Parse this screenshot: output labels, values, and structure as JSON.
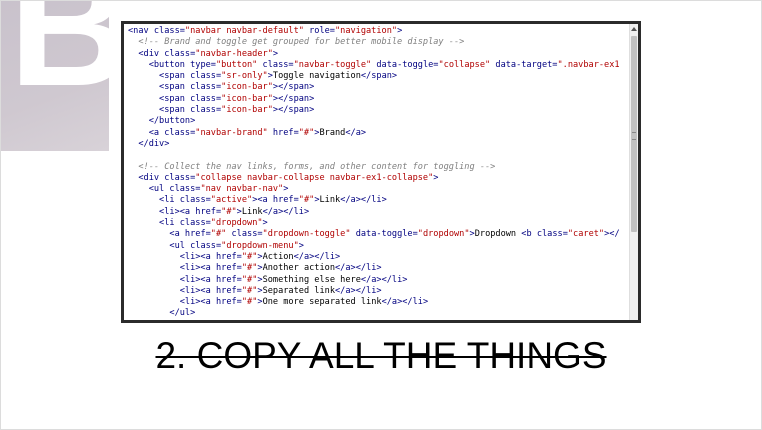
{
  "logo": {
    "letter": "B"
  },
  "code_lines": [
    [
      {
        "t": "tag",
        "v": "<nav "
      },
      {
        "t": "attr",
        "v": "class="
      },
      {
        "t": "str",
        "v": "\"navbar navbar-default\""
      },
      {
        "t": "attr",
        "v": " role="
      },
      {
        "t": "str",
        "v": "\"navigation\""
      },
      {
        "t": "tag",
        "v": ">"
      }
    ],
    [
      {
        "t": "comment",
        "v": "  <!-- Brand and toggle get grouped for better mobile display -->"
      }
    ],
    [
      {
        "t": "tag",
        "v": "  <div "
      },
      {
        "t": "attr",
        "v": "class="
      },
      {
        "t": "str",
        "v": "\"navbar-header\""
      },
      {
        "t": "tag",
        "v": ">"
      }
    ],
    [
      {
        "t": "tag",
        "v": "    <button "
      },
      {
        "t": "attr",
        "v": "type="
      },
      {
        "t": "str",
        "v": "\"button\""
      },
      {
        "t": "attr",
        "v": " class="
      },
      {
        "t": "str",
        "v": "\"navbar-toggle\""
      },
      {
        "t": "attr",
        "v": " data-toggle="
      },
      {
        "t": "str",
        "v": "\"collapse\""
      },
      {
        "t": "attr",
        "v": " data-target="
      },
      {
        "t": "str",
        "v": "\".navbar-ex1"
      }
    ],
    [
      {
        "t": "tag",
        "v": "      <span "
      },
      {
        "t": "attr",
        "v": "class="
      },
      {
        "t": "str",
        "v": "\"sr-only\""
      },
      {
        "t": "tag",
        "v": ">"
      },
      {
        "t": "text",
        "v": "Toggle navigation"
      },
      {
        "t": "tag",
        "v": "</span>"
      }
    ],
    [
      {
        "t": "tag",
        "v": "      <span "
      },
      {
        "t": "attr",
        "v": "class="
      },
      {
        "t": "str",
        "v": "\"icon-bar\""
      },
      {
        "t": "tag",
        "v": "></span>"
      }
    ],
    [
      {
        "t": "tag",
        "v": "      <span "
      },
      {
        "t": "attr",
        "v": "class="
      },
      {
        "t": "str",
        "v": "\"icon-bar\""
      },
      {
        "t": "tag",
        "v": "></span>"
      }
    ],
    [
      {
        "t": "tag",
        "v": "      <span "
      },
      {
        "t": "attr",
        "v": "class="
      },
      {
        "t": "str",
        "v": "\"icon-bar\""
      },
      {
        "t": "tag",
        "v": "></span>"
      }
    ],
    [
      {
        "t": "tag",
        "v": "    </button>"
      }
    ],
    [
      {
        "t": "tag",
        "v": "    <a "
      },
      {
        "t": "attr",
        "v": "class="
      },
      {
        "t": "str",
        "v": "\"navbar-brand\""
      },
      {
        "t": "attr",
        "v": " href="
      },
      {
        "t": "str",
        "v": "\"#\""
      },
      {
        "t": "tag",
        "v": ">"
      },
      {
        "t": "text",
        "v": "Brand"
      },
      {
        "t": "tag",
        "v": "</a>"
      }
    ],
    [
      {
        "t": "tag",
        "v": "  </div>"
      }
    ],
    [
      {
        "t": "text",
        "v": ""
      }
    ],
    [
      {
        "t": "comment",
        "v": "  <!-- Collect the nav links, forms, and other content for toggling -->"
      }
    ],
    [
      {
        "t": "tag",
        "v": "  <div "
      },
      {
        "t": "attr",
        "v": "class="
      },
      {
        "t": "str",
        "v": "\"collapse navbar-collapse navbar-ex1-collapse\""
      },
      {
        "t": "tag",
        "v": ">"
      }
    ],
    [
      {
        "t": "tag",
        "v": "    <ul "
      },
      {
        "t": "attr",
        "v": "class="
      },
      {
        "t": "str",
        "v": "\"nav navbar-nav\""
      },
      {
        "t": "tag",
        "v": ">"
      }
    ],
    [
      {
        "t": "tag",
        "v": "      <li "
      },
      {
        "t": "attr",
        "v": "class="
      },
      {
        "t": "str",
        "v": "\"active\""
      },
      {
        "t": "tag",
        "v": "><a "
      },
      {
        "t": "attr",
        "v": "href="
      },
      {
        "t": "str",
        "v": "\"#\""
      },
      {
        "t": "tag",
        "v": ">"
      },
      {
        "t": "text",
        "v": "Link"
      },
      {
        "t": "tag",
        "v": "</a></li>"
      }
    ],
    [
      {
        "t": "tag",
        "v": "      <li><a "
      },
      {
        "t": "attr",
        "v": "href="
      },
      {
        "t": "str",
        "v": "\"#\""
      },
      {
        "t": "tag",
        "v": ">"
      },
      {
        "t": "text",
        "v": "Link"
      },
      {
        "t": "tag",
        "v": "</a></li>"
      }
    ],
    [
      {
        "t": "tag",
        "v": "      <li "
      },
      {
        "t": "attr",
        "v": "class="
      },
      {
        "t": "str",
        "v": "\"dropdown\""
      },
      {
        "t": "tag",
        "v": ">"
      }
    ],
    [
      {
        "t": "tag",
        "v": "        <a "
      },
      {
        "t": "attr",
        "v": "href="
      },
      {
        "t": "str",
        "v": "\"#\""
      },
      {
        "t": "attr",
        "v": " class="
      },
      {
        "t": "str",
        "v": "\"dropdown-toggle\""
      },
      {
        "t": "attr",
        "v": " data-toggle="
      },
      {
        "t": "str",
        "v": "\"dropdown\""
      },
      {
        "t": "tag",
        "v": ">"
      },
      {
        "t": "text",
        "v": "Dropdown "
      },
      {
        "t": "tag",
        "v": "<b "
      },
      {
        "t": "attr",
        "v": "class="
      },
      {
        "t": "str",
        "v": "\"caret\""
      },
      {
        "t": "tag",
        "v": "></"
      }
    ],
    [
      {
        "t": "tag",
        "v": "        <ul "
      },
      {
        "t": "attr",
        "v": "class="
      },
      {
        "t": "str",
        "v": "\"dropdown-menu\""
      },
      {
        "t": "tag",
        "v": ">"
      }
    ],
    [
      {
        "t": "tag",
        "v": "          <li><a "
      },
      {
        "t": "attr",
        "v": "href="
      },
      {
        "t": "str",
        "v": "\"#\""
      },
      {
        "t": "tag",
        "v": ">"
      },
      {
        "t": "text",
        "v": "Action"
      },
      {
        "t": "tag",
        "v": "</a></li>"
      }
    ],
    [
      {
        "t": "tag",
        "v": "          <li><a "
      },
      {
        "t": "attr",
        "v": "href="
      },
      {
        "t": "str",
        "v": "\"#\""
      },
      {
        "t": "tag",
        "v": ">"
      },
      {
        "t": "text",
        "v": "Another action"
      },
      {
        "t": "tag",
        "v": "</a></li>"
      }
    ],
    [
      {
        "t": "tag",
        "v": "          <li><a "
      },
      {
        "t": "attr",
        "v": "href="
      },
      {
        "t": "str",
        "v": "\"#\""
      },
      {
        "t": "tag",
        "v": ">"
      },
      {
        "t": "text",
        "v": "Something else here"
      },
      {
        "t": "tag",
        "v": "</a></li>"
      }
    ],
    [
      {
        "t": "tag",
        "v": "          <li><a "
      },
      {
        "t": "attr",
        "v": "href="
      },
      {
        "t": "str",
        "v": "\"#\""
      },
      {
        "t": "tag",
        "v": ">"
      },
      {
        "t": "text",
        "v": "Separated link"
      },
      {
        "t": "tag",
        "v": "</a></li>"
      }
    ],
    [
      {
        "t": "tag",
        "v": "          <li><a "
      },
      {
        "t": "attr",
        "v": "href="
      },
      {
        "t": "str",
        "v": "\"#\""
      },
      {
        "t": "tag",
        "v": ">"
      },
      {
        "t": "text",
        "v": "One more separated link"
      },
      {
        "t": "tag",
        "v": "</a></li>"
      }
    ],
    [
      {
        "t": "tag",
        "v": "        </ul>"
      }
    ]
  ],
  "caption": {
    "text": "2. COPY ALL THE THINGS"
  },
  "colors": {
    "tag": "#000080",
    "string": "#b00000",
    "comment": "#808080",
    "logo_bg": "#cfc8d0"
  },
  "icons": {
    "scroll_up": "chevron-up-icon",
    "scroll_grip": "grip-icon"
  }
}
